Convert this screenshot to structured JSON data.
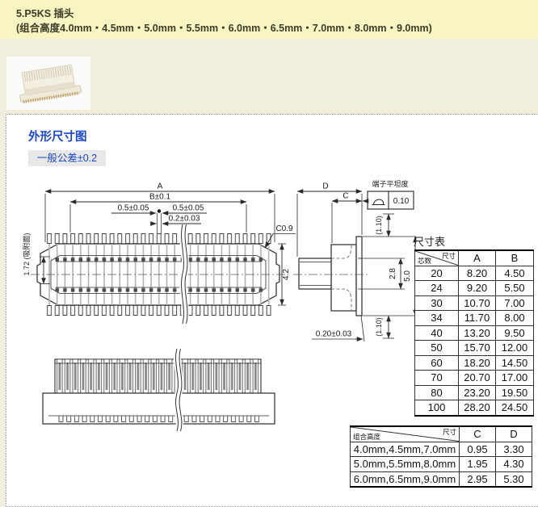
{
  "header": {
    "title": "5.P5KS 插头",
    "subtitle": "(组合高度4.0mm・4.5mm・5.0mm・5.5mm・6.0mm・6.5mm・7.0mm・8.0mm・9.0mm)"
  },
  "section": {
    "title": "外形尺寸图",
    "tolerance": "一般公差±0.2"
  },
  "drawing": {
    "dim_a": "A",
    "dim_b": "B±0.1",
    "dim_05_left": "0.5±0.05",
    "dim_05_right": "0.5±0.05",
    "dim_02": "0.2±0.03",
    "dim_172": "1.72 (吸附面)",
    "dim_c09": "C0.9",
    "dim_42": "4.2",
    "dim_d": "D",
    "dim_c": "C",
    "flatness_label": "端子平坦度",
    "flatness_value": "0.10",
    "dim_110_top": "(1.10)",
    "dim_28": "2.8",
    "dim_50": "5.0",
    "dim_110_bottom": "(1.10)",
    "dim_020": "0.20±0.03"
  },
  "size_table": {
    "title": "尺寸表",
    "diag_top": "尺寸",
    "diag_bottom": "芯数",
    "col_a": "A",
    "col_b": "B",
    "rows": [
      {
        "pins": "20",
        "a": "8.20",
        "b": "4.50"
      },
      {
        "pins": "24",
        "a": "9.20",
        "b": "5.50"
      },
      {
        "pins": "30",
        "a": "10.70",
        "b": "7.00"
      },
      {
        "pins": "34",
        "a": "11.70",
        "b": "8.00"
      },
      {
        "pins": "40",
        "a": "13.20",
        "b": "9.50"
      },
      {
        "pins": "50",
        "a": "15.70",
        "b": "12.00"
      },
      {
        "pins": "60",
        "a": "18.20",
        "b": "14.50"
      },
      {
        "pins": "70",
        "a": "20.70",
        "b": "17.00"
      },
      {
        "pins": "80",
        "a": "23.20",
        "b": "19.50"
      },
      {
        "pins": "100",
        "a": "28.20",
        "b": "24.50"
      }
    ]
  },
  "height_table": {
    "diag_top": "尺寸",
    "diag_bottom": "组合高度",
    "col_c": "C",
    "col_d": "D",
    "rows": [
      {
        "h": "4.0mm,4.5mm,7.0mm",
        "c": "0.95",
        "d": "3.30"
      },
      {
        "h": "5.0mm,5.5mm,8.0mm",
        "c": "1.95",
        "d": "4.30"
      },
      {
        "h": "6.0mm,6.5mm,9.0mm",
        "c": "2.95",
        "d": "5.30"
      }
    ]
  },
  "colors": {
    "accent_blue": "#1a46cc",
    "band_bg": "#f8f5c2",
    "page_bg": "#f1eedd",
    "table_gray": "#c6c6c6"
  }
}
